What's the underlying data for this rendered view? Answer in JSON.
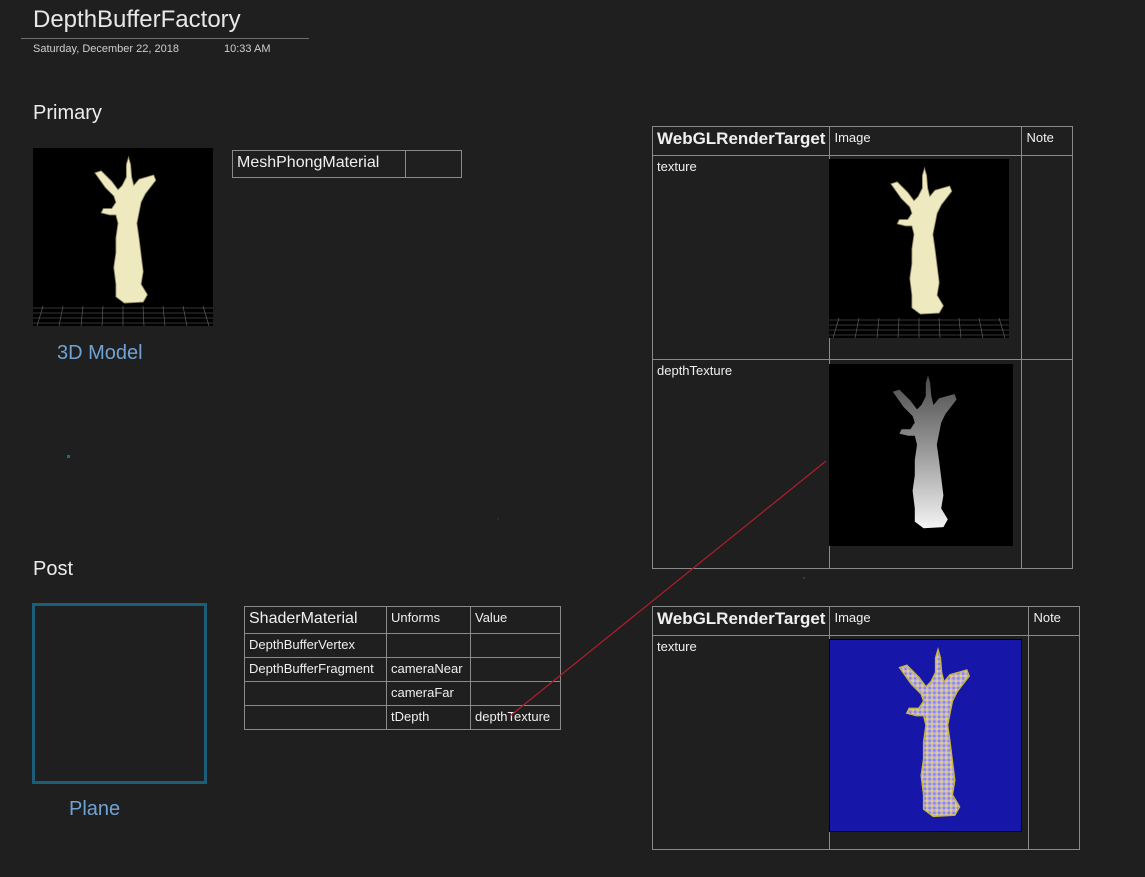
{
  "page": {
    "title": "DepthBufferFactory",
    "date": "Saturday, December 22, 2018",
    "time": "10:33 AM"
  },
  "primary": {
    "heading": "Primary",
    "model_caption": "3D Model",
    "material": "MeshPhongMaterial"
  },
  "post": {
    "heading": "Post",
    "plane_caption": "Plane",
    "shader_table": {
      "headers": [
        "ShaderMaterial",
        "Unforms",
        "Value"
      ],
      "rows": [
        [
          "DepthBufferVertex",
          "",
          ""
        ],
        [
          "DepthBufferFragment",
          "cameraNear",
          ""
        ],
        [
          "",
          "cameraFar",
          ""
        ],
        [
          "",
          "tDepth",
          "depthTexture"
        ]
      ]
    }
  },
  "render_target_1": {
    "headers": [
      "WebGLRenderTarget",
      "Image",
      "Note"
    ],
    "rows": [
      {
        "label": "texture",
        "image": "statue-render-image"
      },
      {
        "label": "depthTexture",
        "image": "statue-depth-image"
      }
    ]
  },
  "render_target_2": {
    "headers": [
      "WebGLRenderTarget",
      "Image",
      "Note"
    ],
    "rows": [
      {
        "label": "texture",
        "image": "statue-depth-visualization-image"
      }
    ]
  },
  "colors": {
    "background": "#201f1f",
    "material_label": "#ff1a1a",
    "caption": "#6fa3d4",
    "plane_border": "#1a5e79",
    "connector_line": "#b01e2a",
    "depth_vis_background": "#1616a8"
  }
}
